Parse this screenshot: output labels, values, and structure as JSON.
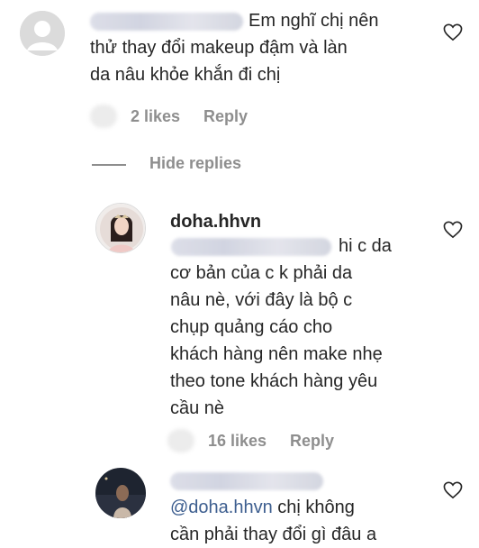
{
  "comments": [
    {
      "text_lines": [
        "Em nghĩ chị nên",
        "thử thay đổi makeup đậm và làn",
        "da nâu khỏe khắn đi chị"
      ],
      "likes": "2 likes",
      "reply": "Reply",
      "hide_replies": "Hide replies"
    }
  ],
  "replies": [
    {
      "username": "doha.hhvn",
      "text_lines": [
        "hi c da",
        "cơ bản của c k phải da",
        "nâu nè, với đây là bộ c",
        "chụp quảng cáo cho",
        "khách hàng nên make nhẹ",
        "theo tone khách hàng yêu",
        "cầu nè"
      ],
      "likes": "16 likes",
      "reply": "Reply"
    },
    {
      "mention": "@doha.hhvn",
      "text_lines": [
        "chị không",
        "cần phải thay đổi gì đâu a"
      ]
    }
  ],
  "icons": {
    "like": "heart-outline-icon",
    "avatar_default": "default-user-avatar-icon"
  },
  "colors": {
    "text": "#262626",
    "meta": "#8e8e8e",
    "mention": "#3d5e8f",
    "background": "#ffffff"
  }
}
